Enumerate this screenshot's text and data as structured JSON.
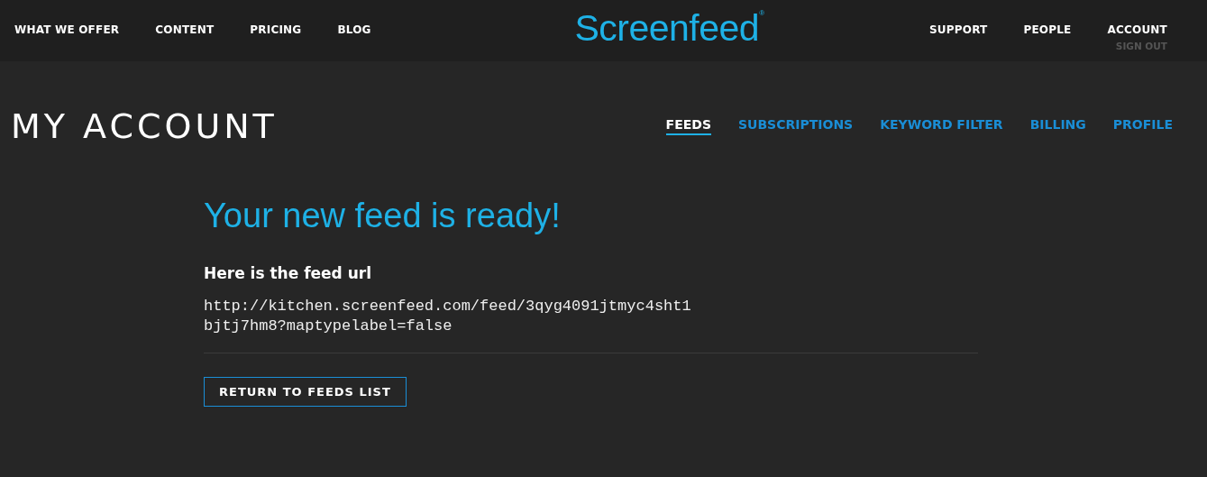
{
  "header": {
    "nav_left": [
      "WHAT WE OFFER",
      "CONTENT",
      "PRICING",
      "BLOG"
    ],
    "logo": "Screenfeed",
    "logo_mark": "®",
    "nav_right": [
      "SUPPORT",
      "PEOPLE",
      "ACCOUNT"
    ],
    "sign_out": "SIGN OUT"
  },
  "page": {
    "title": "MY ACCOUNT",
    "tabs": [
      {
        "label": "FEEDS",
        "selected": true
      },
      {
        "label": "SUBSCRIPTIONS",
        "selected": false
      },
      {
        "label": "KEYWORD FILTER",
        "selected": false
      },
      {
        "label": "BILLING",
        "selected": false
      },
      {
        "label": "PROFILE",
        "selected": false
      }
    ]
  },
  "content": {
    "heading": "Your new feed is ready!",
    "subheading": "Here is the feed url",
    "url": "http://kitchen.screenfeed.com/feed/3qyg4091jtmyc4sht1bjtj7hm8?maptypelabel=false",
    "button": "RETURN TO FEEDS LIST"
  }
}
